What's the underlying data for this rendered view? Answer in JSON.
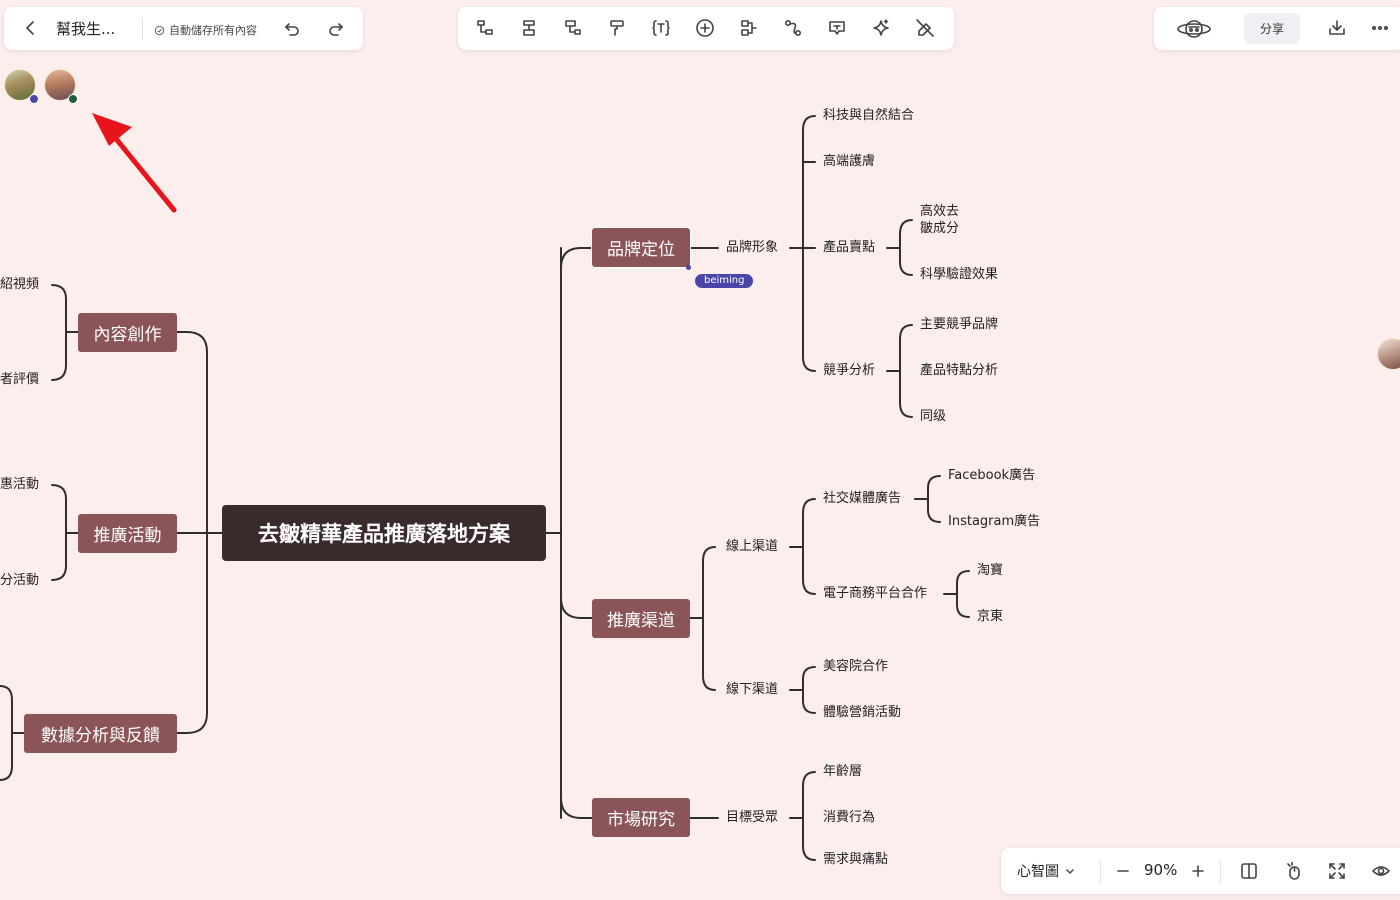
{
  "header": {
    "doc_title": "幫我生...",
    "autosave": "自動儲存所有內容",
    "share_label": "分享"
  },
  "toolbar": {
    "icons": [
      "insert-child-node-icon",
      "insert-sibling-node-icon",
      "insert-parent-node-icon",
      "format-painter-icon",
      "text-style-icon",
      "add-icon",
      "connector-icon",
      "relationship-icon",
      "summary-icon",
      "ai-sparkle-icon",
      "clear-format-icon"
    ]
  },
  "mindmap": {
    "root": "去皺精華產品推廣落地方案",
    "left_branches": [
      {
        "label": "內容創作",
        "children": [
          "紹視頻",
          "者評價"
        ]
      },
      {
        "label": "推廣活動",
        "children": [
          "惠活動",
          "分活動"
        ]
      },
      {
        "label": "數據分析與反饋",
        "children": []
      }
    ],
    "right_branches": [
      {
        "label": "品牌定位",
        "children": [
          {
            "label": "品牌形象",
            "children": [
              {
                "label": "科技與自然結合"
              },
              {
                "label": "高端護膚"
              },
              {
                "label": "產品賣點",
                "children": [
                  "高效去\n皺成分",
                  "科學驗證效果"
                ]
              },
              {
                "label": "競爭分析",
                "children": [
                  "主要競爭品牌",
                  "產品特點分析",
                  "同级"
                ]
              }
            ]
          }
        ]
      },
      {
        "label": "推廣渠道",
        "children": [
          {
            "label": "線上渠道",
            "children": [
              {
                "label": "社交媒體廣告",
                "children": [
                  "Facebook廣告",
                  "Instagram廣告"
                ]
              },
              {
                "label": "電子商務平台合作",
                "children": [
                  "淘寶",
                  "京東"
                ]
              }
            ]
          },
          {
            "label": "線下渠道",
            "children": [
              {
                "label": "美容院合作"
              },
              {
                "label": "體驗營銷活動"
              }
            ]
          }
        ]
      },
      {
        "label": "市場研究",
        "children": [
          {
            "label": "目標受眾",
            "children": [
              {
                "label": "年齡層"
              },
              {
                "label": "消費行為"
              },
              {
                "label": "需求與痛點"
              }
            ]
          }
        ]
      }
    ]
  },
  "collaborator_cursor": {
    "name": "beiming",
    "color": "#4a46a8"
  },
  "avatars": [
    {
      "status_color": "#4a46a8"
    },
    {
      "status_color": "#1f5f3a"
    }
  ],
  "footer": {
    "view_mode": "心智圖",
    "zoom": "90%"
  },
  "colors": {
    "background": "#fdeeee",
    "root_node": "#3b2a2c",
    "main_node": "#8b5557",
    "annotation_arrow": "#e8141b"
  }
}
